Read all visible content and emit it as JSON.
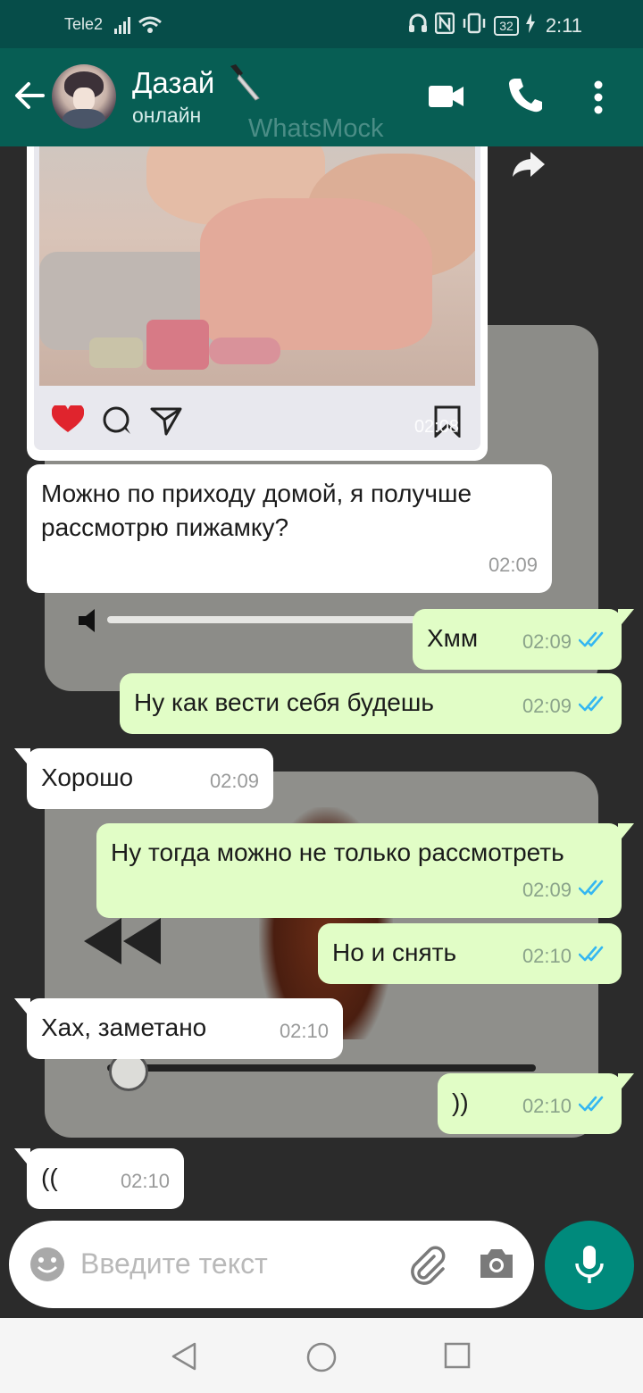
{
  "status_bar": {
    "carrier": "Tele2",
    "battery": "32",
    "time": "2:11"
  },
  "header": {
    "contact_name": "Дазай",
    "contact_status": "онлайн",
    "watermark": "WhatsMock",
    "icons": [
      "back-arrow-icon",
      "knife-emoji-icon",
      "video-call-icon",
      "phone-call-icon",
      "more-vertical-icon"
    ]
  },
  "image_message": {
    "time": "02:08",
    "icons": [
      "heart-icon",
      "comment-icon",
      "send-icon",
      "bookmark-icon",
      "forward-icon"
    ]
  },
  "messages": [
    {
      "direction": "in",
      "text": "Можно по приходу домой, я получше рассмотрю пижамку?",
      "time": "02:09"
    },
    {
      "direction": "out",
      "text": "Хмм",
      "time": "02:09",
      "status": "read"
    },
    {
      "direction": "out",
      "text": "Ну как вести себя будешь",
      "time": "02:09",
      "status": "read"
    },
    {
      "direction": "in",
      "text": "Хорошо",
      "time": "02:09"
    },
    {
      "direction": "out",
      "text": "Ну тогда можно не только рассмотреть",
      "time": "02:09",
      "status": "read"
    },
    {
      "direction": "out",
      "text": "Но и снять",
      "time": "02:10",
      "status": "read"
    },
    {
      "direction": "in",
      "text": "Хах, заметано",
      "time": "02:10"
    },
    {
      "direction": "out",
      "text": "))",
      "time": "02:10",
      "status": "read"
    },
    {
      "direction": "in",
      "text": "((",
      "time": "02:10"
    }
  ],
  "composer": {
    "placeholder": "Введите текст"
  },
  "colors": {
    "header": "#075e54",
    "status_bar": "#064d49",
    "outgoing_bubble": "#e1fdc6",
    "incoming_bubble": "#ffffff",
    "read_ticks": "#34b7f1",
    "mic_button": "#008a7c"
  }
}
